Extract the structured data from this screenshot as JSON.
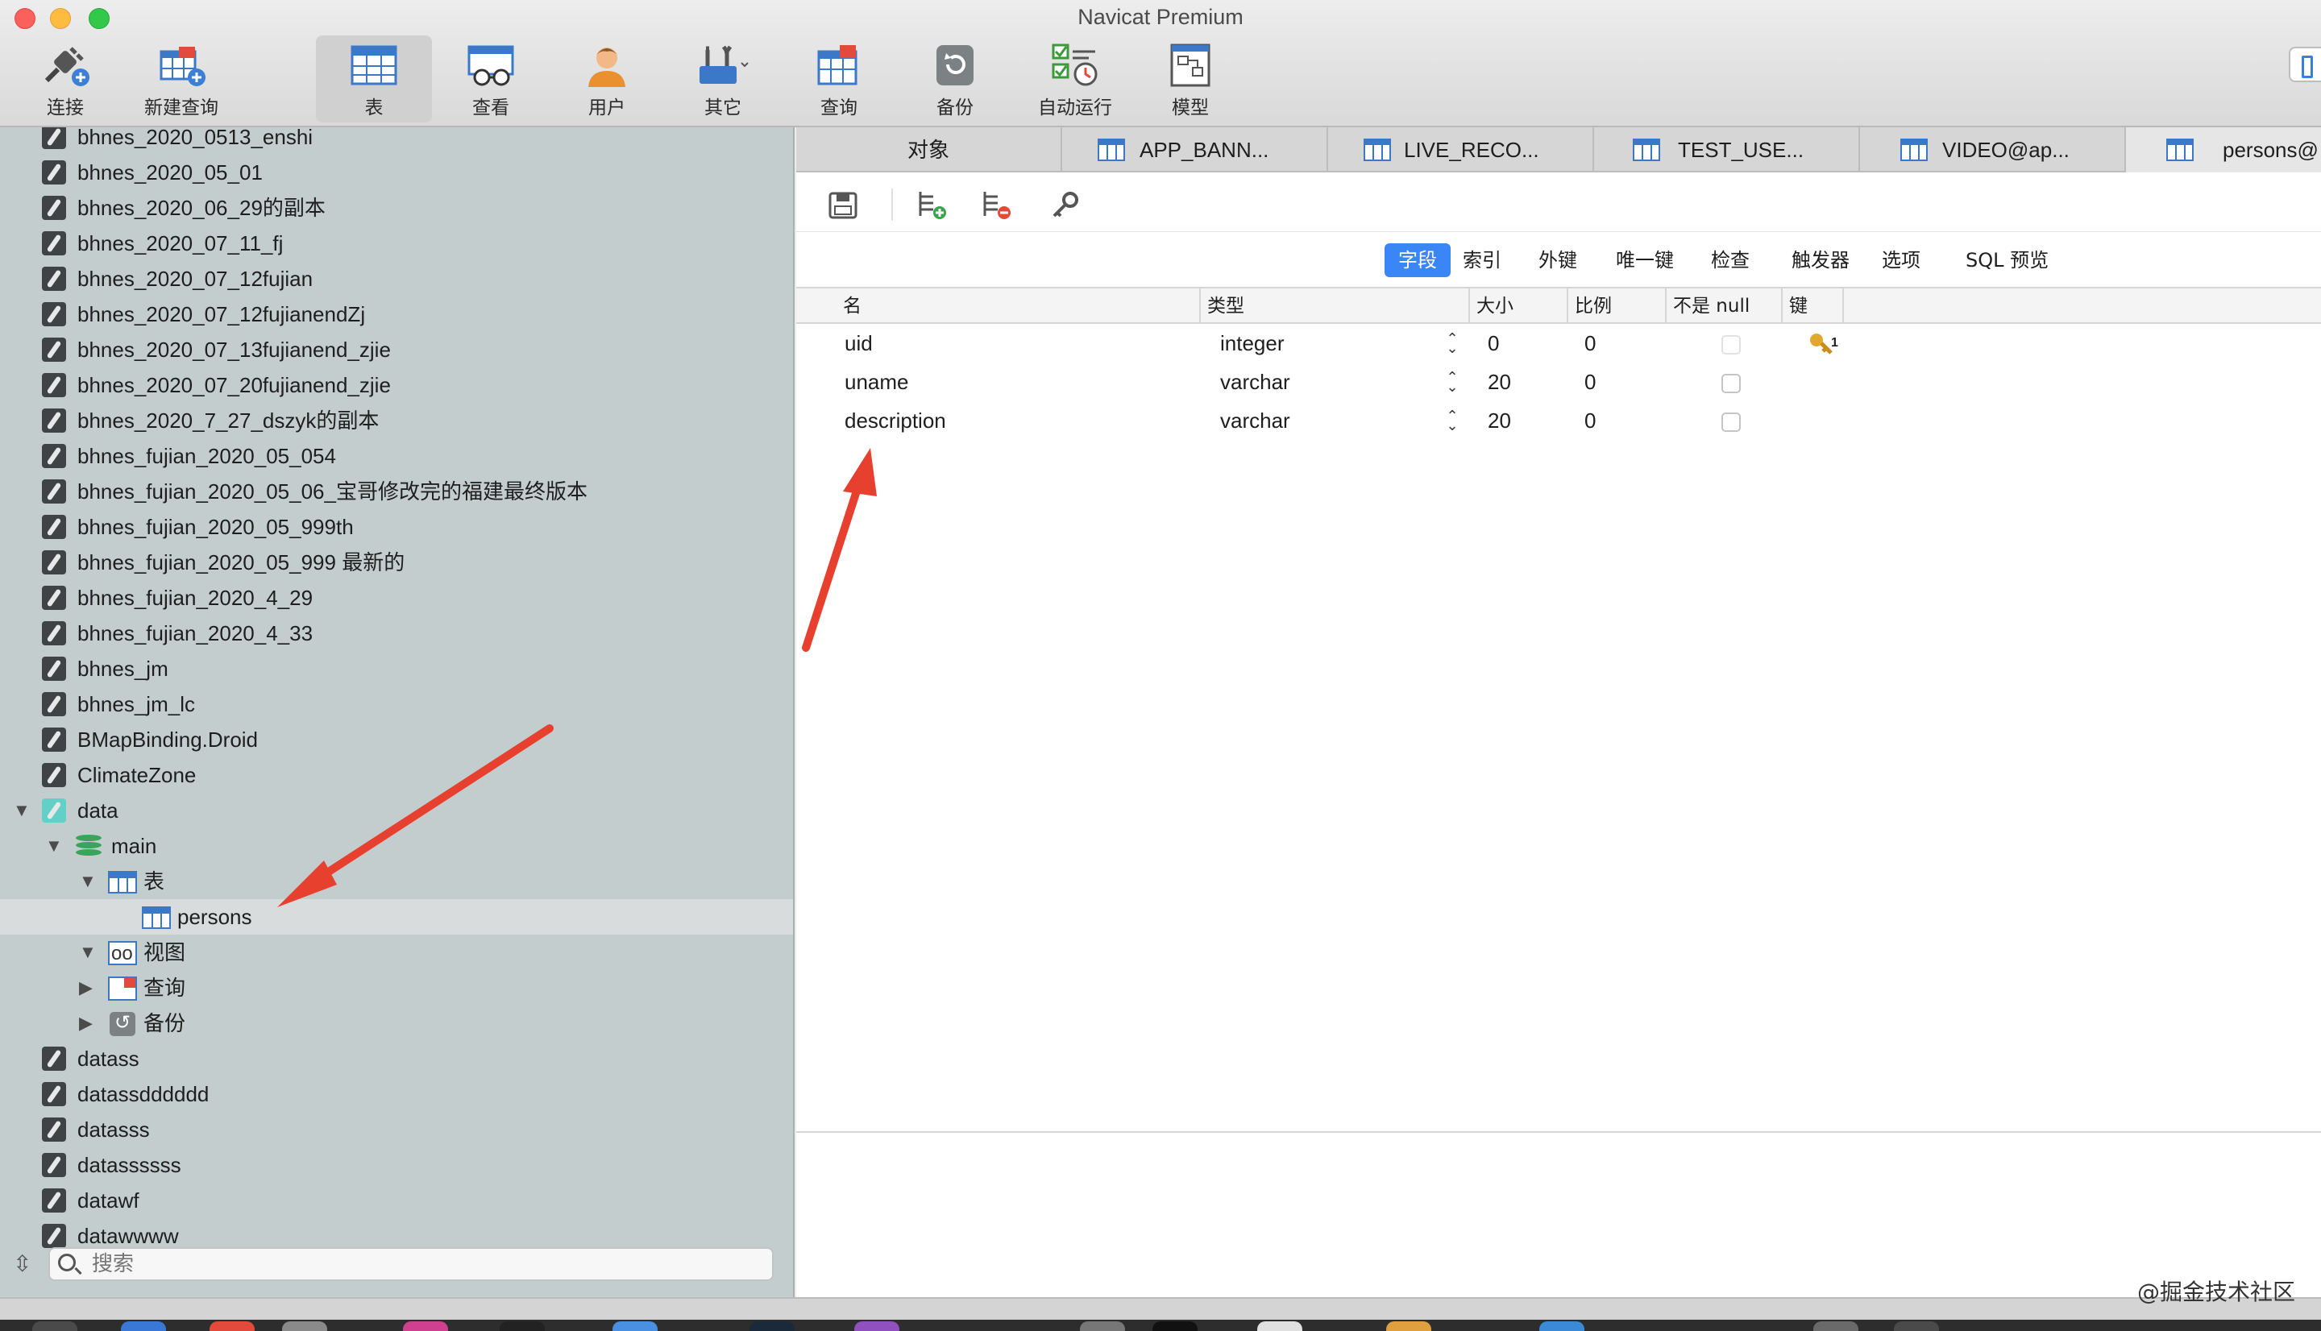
{
  "window": {
    "title": "Navicat Premium"
  },
  "toolbar": {
    "items": [
      {
        "label": "连接",
        "icon": "plug-connect-icon"
      },
      {
        "label": "新建查询",
        "icon": "new-query-icon"
      },
      {
        "label": "表",
        "icon": "table-icon"
      },
      {
        "label": "查看",
        "icon": "view-glasses-icon"
      },
      {
        "label": "用户",
        "icon": "user-icon"
      },
      {
        "label": "其它",
        "icon": "tools-icon"
      },
      {
        "label": "查询",
        "icon": "query-icon"
      },
      {
        "label": "备份",
        "icon": "backup-icon"
      },
      {
        "label": "自动运行",
        "icon": "auto-run-icon"
      },
      {
        "label": "模型",
        "icon": "model-icon"
      }
    ]
  },
  "sidebar": {
    "connections": [
      "bhnes_2020_0513_enshi",
      "bhnes_2020_05_01",
      "bhnes_2020_06_29的副本",
      "bhnes_2020_07_11_fj",
      "bhnes_2020_07_12fujian",
      "bhnes_2020_07_12fujianendZj",
      "bhnes_2020_07_13fujianend_zjie",
      "bhnes_2020_07_20fujianend_zjie",
      "bhnes_2020_7_27_dszyk的副本",
      "bhnes_fujian_2020_05_054",
      "bhnes_fujian_2020_05_06_宝哥修改完的福建最终版本",
      "bhnes_fujian_2020_05_999th",
      "bhnes_fujian_2020_05_999 最新的",
      "bhnes_fujian_2020_4_29",
      "bhnes_fujian_2020_4_33",
      "bhnes_jm",
      "bhnes_jm_lc",
      "BMapBinding.Droid",
      "ClimateZone"
    ],
    "data_node": {
      "name": "data",
      "schema": "main",
      "tables_group": "表",
      "selected_table": "persons",
      "views_group": "视图",
      "queries_group": "查询",
      "backups_group": "备份"
    },
    "more_connections": [
      "datass",
      "datassdddddd",
      "datasss",
      "datassssss",
      "datawf",
      "datawwww"
    ],
    "search": {
      "placeholder": "搜索",
      "value": ""
    }
  },
  "tabs": [
    {
      "label": "对象"
    },
    {
      "label": "APP_BANN..."
    },
    {
      "label": "LIVE_RECO..."
    },
    {
      "label": "TEST_USE..."
    },
    {
      "label": "VIDEO@ap..."
    },
    {
      "label": "persons@"
    }
  ],
  "editor": {
    "toolbar_icons": [
      "save-icon",
      "add-field-icon",
      "delete-field-icon",
      "primary-key-icon"
    ],
    "subtabs": [
      "字段",
      "索引",
      "外键",
      "唯一键",
      "检查",
      "触发器",
      "选项",
      "SQL 预览"
    ],
    "active_subtab": "字段",
    "columns": [
      "名",
      "类型",
      "大小",
      "比例",
      "不是 null",
      "键"
    ],
    "rows": [
      {
        "name": "uid",
        "type": "integer",
        "size": "0",
        "scale": "0",
        "not_null": false,
        "key": "1"
      },
      {
        "name": "uname",
        "type": "varchar",
        "size": "20",
        "scale": "0",
        "not_null": false,
        "key": ""
      },
      {
        "name": "description",
        "type": "varchar",
        "size": "20",
        "scale": "0",
        "not_null": false,
        "key": ""
      }
    ]
  },
  "watermark": "@掘金技术社区",
  "colors": {
    "accent": "#3b86f7",
    "arrow": "#e8402f",
    "sidebar": "#c4cdce"
  }
}
